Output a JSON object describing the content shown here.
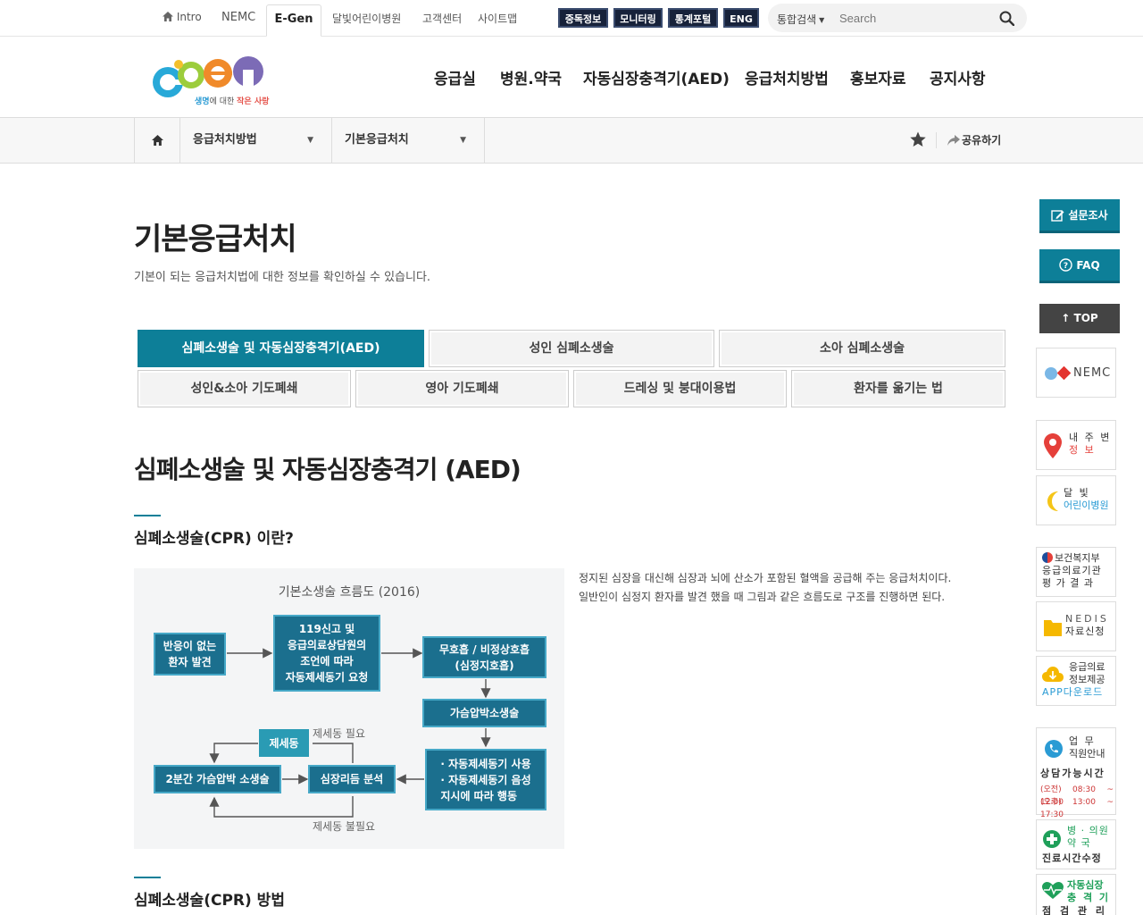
{
  "util": {
    "intro": "Intro",
    "nemc": "NEMC",
    "egen": "E-Gen",
    "moonlight": "달빛어린이병원",
    "customer": "고객센터",
    "sitemap": "사이트맵",
    "dark_buttons": [
      "중독정보",
      "모니터링",
      "통계포털",
      "ENG"
    ],
    "search_scope": "통합검색",
    "search_placeholder": "Search"
  },
  "logo": {
    "tagline_a": "생명",
    "tagline_b": "에 대한 ",
    "tagline_c": "작은 사랑"
  },
  "gnb": [
    "응급실",
    "병원.약국",
    "자동심장충격기(AED)",
    "응급처치방법",
    "홍보자료",
    "공지사항"
  ],
  "breadcrumb": {
    "level1": "응급처치방법",
    "level2": "기본응급처치",
    "share": "공유하기"
  },
  "page": {
    "title": "기본응급처치",
    "desc": "기본이 되는 응급처치법에 대한 정보를 확인하실 수 있습니다."
  },
  "tabs": [
    "심폐소생술 및 자동심장충격기(AED)",
    "성인 심폐소생술",
    "소아 심폐소생술",
    "성인&소아 기도폐쇄",
    "영아 기도폐쇄",
    "드레싱 및 붕대이용법",
    "환자를 옮기는 법"
  ],
  "section": {
    "title": "심폐소생술 및 자동심장충격기 (AED)",
    "sub1": "심폐소생술(CPR) 이란?",
    "sub2": "심폐소생술(CPR) 방법",
    "explain_1": "정지된 심장을 대신해 심장과 뇌에 산소가 포함된 혈액을 공급해 주는 응급처치이다.",
    "explain_2": "일반인이 심정지 환자를 발견 했을 때 그림과 같은 흐름도로 구조를 진행하면 된다."
  },
  "flowchart": {
    "title": "기본소생술 흐름도 (2016)",
    "b_find": "반응이 없는\n환자 발견",
    "b_call": "119신고 및\n응급의료상담원의\n조언에 따라\n자동제세동기 요청",
    "b_noresp": "무호흡 / 비정상호흡\n(심정지호흡)",
    "b_cpr": "가슴압박소생술",
    "b_aed": "· 자동제세동기 사용\n· 자동제세동기 음성\n  지시에 따라 행동",
    "b_rhythm": "심장리듬 분석",
    "b_2min": "2분간 가슴압박 소생술",
    "b_defib": "제세동",
    "note_need": "제세동 필요",
    "note_noneed": "제세동 불필요"
  },
  "quick": {
    "survey": "설문조사",
    "faq": "FAQ",
    "top": "TOP",
    "nemc": "NEMC",
    "near_1": "내 주 변",
    "near_2": "정      보",
    "moon_1": "달      빛",
    "moon_2": "어린이병원",
    "eval_1": "보건복지부",
    "eval_2": "응급의료기관",
    "eval_3": "평 가 결 과",
    "nedis_1": "NEDIS",
    "nedis_2": "자료신청",
    "app_1": "응급의료",
    "app_2": "정보제공",
    "app_3": "APP다운로드",
    "hours_1": "업      무",
    "hours_2": "직원안내",
    "hours_3": "상담가능시간",
    "hours_4": "(오전) 08:30 ~ 12:00",
    "hours_5": "(오후) 13:00 ~ 17:30",
    "clinic_1": "병 · 의원",
    "clinic_2": "약      국",
    "clinic_3": "진료시간수정",
    "aed_1": "자동심장",
    "aed_2": "충 격 기",
    "aed_3": "점 검 관 리"
  },
  "colors": {
    "accent": "#0d7f98",
    "flow_box": "#1b6f8e",
    "dark_button": "#17223a"
  }
}
